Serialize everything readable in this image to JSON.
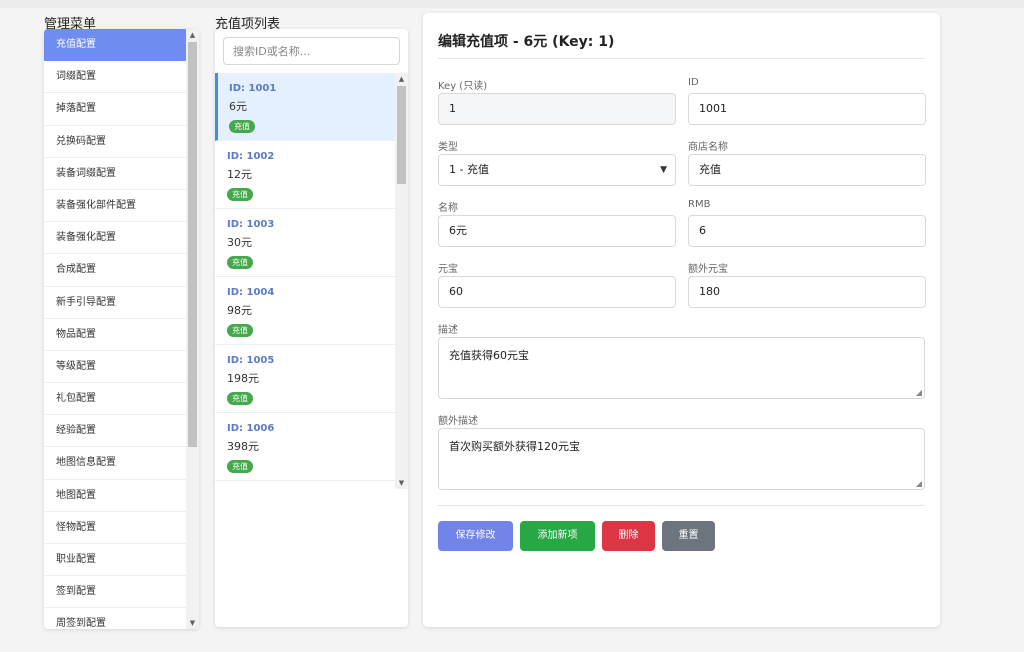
{
  "menu": {
    "title": "管理菜单",
    "items": [
      {
        "label": "充值配置",
        "active": true
      },
      {
        "label": "词缀配置"
      },
      {
        "label": "掉落配置"
      },
      {
        "label": "兑换码配置"
      },
      {
        "label": "装备词缀配置"
      },
      {
        "label": "装备强化部件配置"
      },
      {
        "label": "装备强化配置"
      },
      {
        "label": "合成配置"
      },
      {
        "label": "新手引导配置"
      },
      {
        "label": "物品配置"
      },
      {
        "label": "等级配置"
      },
      {
        "label": "礼包配置"
      },
      {
        "label": "经验配置"
      },
      {
        "label": "地图信息配置"
      },
      {
        "label": "地图配置"
      },
      {
        "label": "怪物配置"
      },
      {
        "label": "职业配置"
      },
      {
        "label": "签到配置"
      },
      {
        "label": "周签到配置"
      }
    ]
  },
  "recharge_list": {
    "title": "充值项列表",
    "search_placeholder": "搜索ID或名称...",
    "items": [
      {
        "id_label": "ID: 1001",
        "name": "6元",
        "tag": "充值",
        "selected": true
      },
      {
        "id_label": "ID: 1002",
        "name": "12元",
        "tag": "充值"
      },
      {
        "id_label": "ID: 1003",
        "name": "30元",
        "tag": "充值"
      },
      {
        "id_label": "ID: 1004",
        "name": "98元",
        "tag": "充值"
      },
      {
        "id_label": "ID: 1005",
        "name": "198元",
        "tag": "充值"
      },
      {
        "id_label": "ID: 1006",
        "name": "398元",
        "tag": "充值"
      }
    ]
  },
  "editor": {
    "title": "编辑充值项 - 6元 (Key: 1)",
    "fields": {
      "key": {
        "label": "Key (只读)",
        "value": "1"
      },
      "id": {
        "label": "ID",
        "value": "1001"
      },
      "type": {
        "label": "类型",
        "value": "1 - 充值"
      },
      "shop_name": {
        "label": "商店名称",
        "value": "充值"
      },
      "name": {
        "label": "名称",
        "value": "6元"
      },
      "rmb": {
        "label": "RMB",
        "value": "6"
      },
      "yuanbao": {
        "label": "元宝",
        "value": "60"
      },
      "extra_yuanbao": {
        "label": "额外元宝",
        "value": "180"
      },
      "description": {
        "label": "描述",
        "value": "充值获得60元宝"
      },
      "extra_description": {
        "label": "额外描述",
        "value": "首次购买额外获得120元宝"
      }
    },
    "buttons": {
      "save": "保存修改",
      "add": "添加新项",
      "delete": "删除",
      "reset": "重置"
    }
  },
  "colors": {
    "active_menu": "#6f8cf0",
    "save": "#7284e8",
    "add": "#28a745",
    "delete": "#dc3545",
    "reset": "#6c757d",
    "tag": "#44a84c"
  }
}
